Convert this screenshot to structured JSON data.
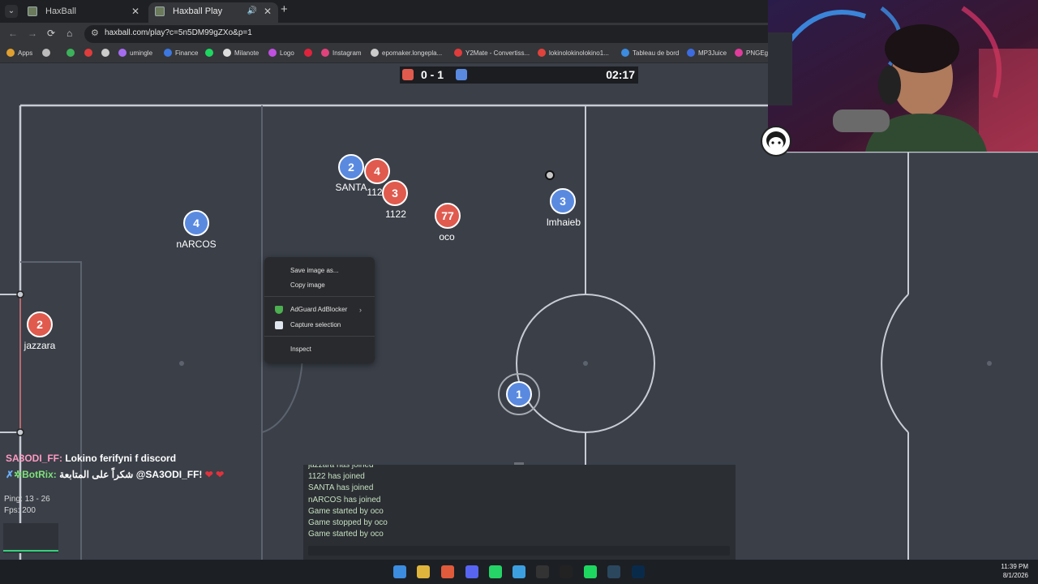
{
  "browser": {
    "tabs": [
      {
        "label": "HaxBall",
        "active": false
      },
      {
        "label": "Haxball Play",
        "active": true
      }
    ],
    "new_tab": "+",
    "tab_menu": "⌄",
    "url": "haxball.com/play?c=5n5DM99gZXo&p=1",
    "nav": {
      "back": "←",
      "forward": "→",
      "reload": "⟳",
      "home": "⌂"
    },
    "bookmarks": [
      {
        "label": "Apps",
        "color": "#e0a030"
      },
      {
        "label": "",
        "color": "#bbbbbb"
      },
      {
        "label": "",
        "color": "#3cb35a"
      },
      {
        "label": "",
        "color": "#e03c3c"
      },
      {
        "label": "",
        "color": "#cccccc"
      },
      {
        "label": "umingle",
        "color": "#a66cf0"
      },
      {
        "label": "Finance",
        "color": "#3c78e0"
      },
      {
        "label": "",
        "color": "#1ed760"
      },
      {
        "label": "Milanote",
        "color": "#dddddd"
      },
      {
        "label": "Logo",
        "color": "#c050e0"
      },
      {
        "label": "",
        "color": "#e0233c"
      },
      {
        "label": "Instagram",
        "color": "#e0437c"
      },
      {
        "label": "epomaker.longepla...",
        "color": "#cccccc"
      },
      {
        "label": "Y2Mate - Convertiss...",
        "color": "#e03c3c"
      },
      {
        "label": "lokinolokinolokino1...",
        "color": "#e0433c"
      },
      {
        "label": "Tableau de bord",
        "color": "#3c8ce0"
      },
      {
        "label": "MP3Juice",
        "color": "#3c6ce0"
      },
      {
        "label": "PNGEgg",
        "color": "#e03c9c"
      }
    ]
  },
  "scoreboard": {
    "score": "0 - 1",
    "time": "02:17",
    "red_color": "#e05a4e",
    "blue_color": "#5a8ae0"
  },
  "players": [
    {
      "number": "2",
      "name": "SANTA",
      "team": "blue"
    },
    {
      "number": "4",
      "name": "112",
      "team": "red"
    },
    {
      "number": "3",
      "name": "1122",
      "team": "red"
    },
    {
      "number": "77",
      "name": "oco",
      "team": "red"
    },
    {
      "number": "3",
      "name": "lmhaieb",
      "team": "blue"
    },
    {
      "number": "4",
      "name": "nARCOS",
      "team": "blue"
    },
    {
      "number": "2",
      "name": "jazzara",
      "team": "red"
    },
    {
      "number": "1",
      "name": "",
      "team": "blue"
    }
  ],
  "context_menu": {
    "items": [
      {
        "label": "Save image as...",
        "icon": ""
      },
      {
        "label": "Copy image",
        "icon": ""
      },
      {
        "label": "AdGuard AdBlocker",
        "icon": "adguard-shield-icon",
        "submenu": "›"
      },
      {
        "label": "Capture selection",
        "icon": "capture-icon"
      },
      {
        "label": "Inspect",
        "icon": ""
      }
    ]
  },
  "stream_chat": [
    {
      "user": "SA3ODI_FF:",
      "text": " Lokino ferifyni f discord"
    },
    {
      "user": "BotRix:",
      "text": " شكراً على المتابعة @SA3ODI_FF! ",
      "hearts": "❤ ❤"
    }
  ],
  "stats": {
    "ping": "Ping: 13 - 26",
    "fps": "Fps: 200"
  },
  "game_chat": [
    "jazzara has joined",
    "1122 has joined",
    "SANTA has joined",
    "nARCOS has joined",
    "Game started by oco",
    "Game stopped by oco",
    "Game started by oco"
  ],
  "taskbar": {
    "apps": [
      "windows-start-icon",
      "file-explorer-icon",
      "chrome-icon",
      "discord-icon",
      "whatsapp-icon",
      "notepad-icon",
      "obs-icon",
      "capcut-icon",
      "spotify-icon",
      "steam-icon",
      "photoshop-icon"
    ],
    "time": "11:39 PM",
    "date": "8/1/2026"
  }
}
